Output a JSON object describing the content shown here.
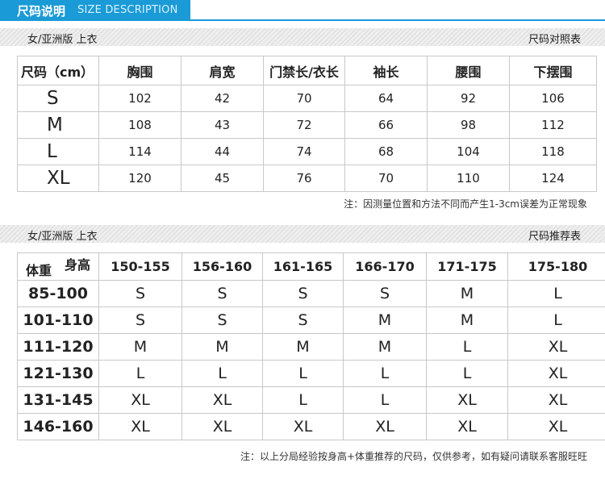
{
  "header": {
    "title_cn": "尺码说明",
    "title_en": "SIZE DESCRIPTION"
  },
  "section1": {
    "left_label": "女/亚洲版   上衣",
    "right_label": "尺码对照表",
    "columns": [
      "尺码（cm）",
      "胸围",
      "肩宽",
      "门禁长/衣长",
      "袖长",
      "腰围",
      "下摆围"
    ],
    "rows": [
      [
        "S",
        "102",
        "42",
        "70",
        "64",
        "92",
        "106"
      ],
      [
        "M",
        "108",
        "43",
        "72",
        "66",
        "98",
        "112"
      ],
      [
        "L",
        "114",
        "44",
        "74",
        "68",
        "104",
        "118"
      ],
      [
        "XL",
        "120",
        "45",
        "76",
        "70",
        "110",
        "124"
      ]
    ],
    "note": "注：因测量位置和方法不同而产生1-3cm误差为正常现象"
  },
  "section2": {
    "left_label": "女/亚洲版   上衣",
    "right_label": "尺码推荐表",
    "corner_height": "身高",
    "corner_weight": "体重",
    "columns": [
      "150-155",
      "156-160",
      "161-165",
      "166-170",
      "171-175",
      "175-180"
    ],
    "rows": [
      [
        "85-100",
        "S",
        "S",
        "S",
        "S",
        "M",
        "L"
      ],
      [
        "101-110",
        "S",
        "S",
        "S",
        "M",
        "M",
        "L"
      ],
      [
        "111-120",
        "M",
        "M",
        "M",
        "M",
        "L",
        "XL"
      ],
      [
        "121-130",
        "L",
        "L",
        "L",
        "L",
        "L",
        "XL"
      ],
      [
        "131-145",
        "XL",
        "XL",
        "L",
        "L",
        "XL",
        "XL"
      ],
      [
        "146-160",
        "XL",
        "XL",
        "XL",
        "XL",
        "XL",
        "XL"
      ]
    ],
    "note": "注：以上分局经验按身高+体重推荐的尺码，仅供参考，如有疑问请联系客服旺旺"
  }
}
